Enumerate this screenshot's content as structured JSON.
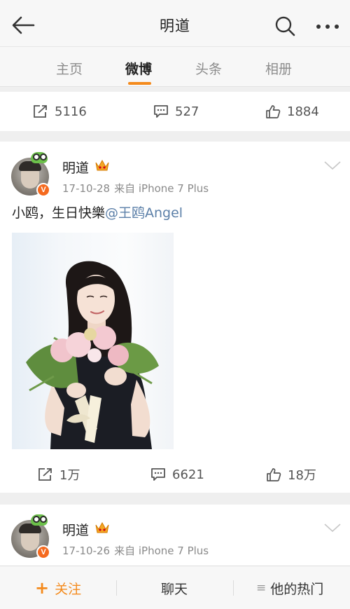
{
  "header": {
    "title": "明道"
  },
  "tabs": [
    {
      "label": "主页",
      "active": false
    },
    {
      "label": "微博",
      "active": true
    },
    {
      "label": "头条",
      "active": false
    },
    {
      "label": "相册",
      "active": false
    }
  ],
  "accent_color": "#f48a1c",
  "top_post_actions": {
    "reposts": "5116",
    "comments": "527",
    "likes": "1884"
  },
  "posts": [
    {
      "author": "明道",
      "date": "17-10-28",
      "source": "来自 iPhone 7 Plus",
      "text": "小鸥，生日快樂",
      "mention": "@王鸥Angel",
      "actions": {
        "reposts": "1万",
        "comments": "6621",
        "likes": "18万"
      }
    },
    {
      "author": "明道",
      "date": "17-10-26",
      "source": "来自 iPhone 7 Plus"
    }
  ],
  "bottom_bar": {
    "follow": "关注",
    "follow_icon": "+",
    "chat": "聊天",
    "hot": "他的热门",
    "hot_icon": "≡"
  },
  "icons": [
    "back-arrow-icon",
    "search-icon",
    "more-icon",
    "repost-icon",
    "comment-icon",
    "like-icon",
    "crown-icon",
    "verified-icon",
    "chevron-down-icon",
    "menu-icon"
  ]
}
